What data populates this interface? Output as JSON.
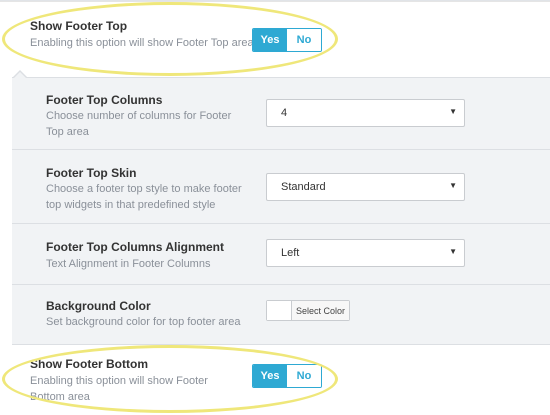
{
  "show_footer_top": {
    "label": "Show Footer Top",
    "description": "Enabling this option will show Footer Top area",
    "toggle": {
      "yes_label": "Yes",
      "no_label": "No",
      "value": "Yes"
    }
  },
  "footer_top_columns": {
    "label": "Footer Top Columns",
    "description": "Choose number of columns for Footer Top area",
    "selected": "4"
  },
  "footer_top_skin": {
    "label": "Footer Top Skin",
    "description": "Choose a footer top style to make footer top widgets in that predefined style",
    "selected": "Standard"
  },
  "footer_top_alignment": {
    "label": "Footer Top Columns Alignment",
    "description": "Text Alignment in Footer Columns",
    "selected": "Left"
  },
  "background_color": {
    "label": "Background Color",
    "description": "Set background color for top footer area",
    "button_label": "Select Color"
  },
  "show_footer_bottom": {
    "label": "Show Footer Bottom",
    "description": "Enabling this option will show Footer Bottom area",
    "toggle": {
      "yes_label": "Yes",
      "no_label": "No",
      "value": "Yes"
    }
  },
  "icons": {
    "dropdown": "caret-down-icon"
  },
  "colors": {
    "toggle_accent": "#2ea9d3",
    "highlight": "#efe77a",
    "subpanel_bg": "#f1f3f5"
  }
}
